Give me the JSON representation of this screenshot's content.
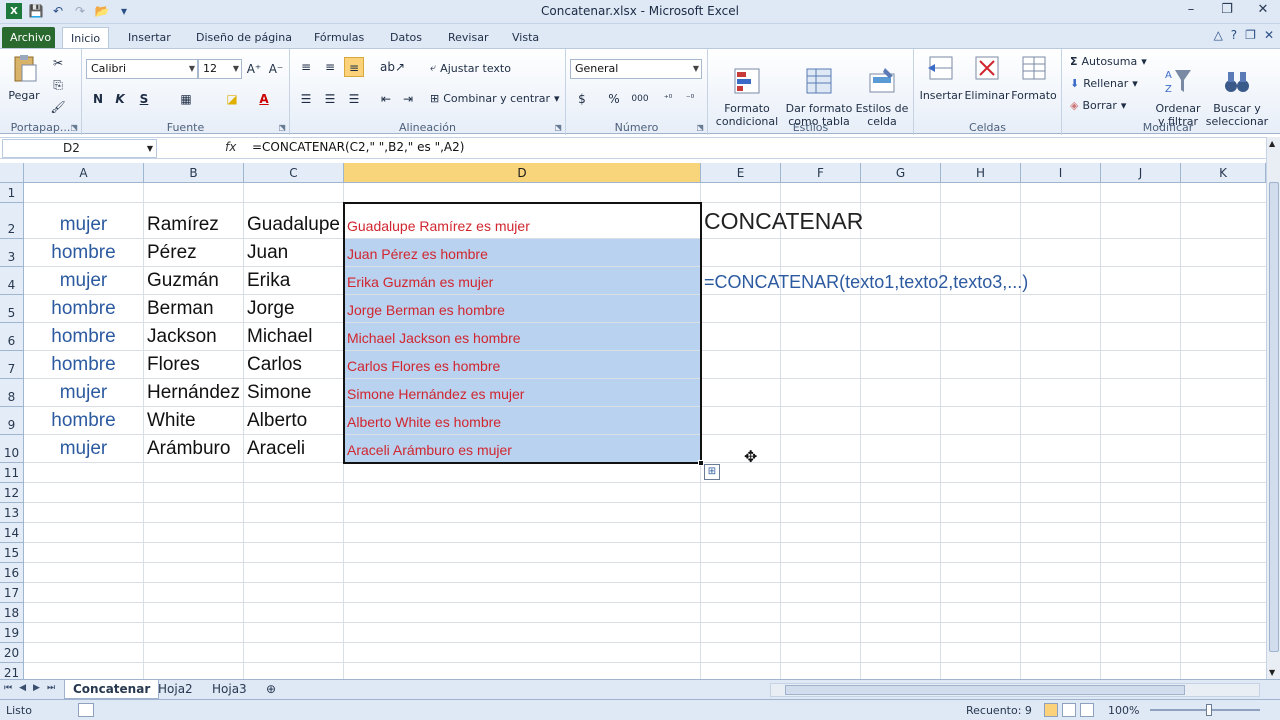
{
  "window": {
    "title": "Concatenar.xlsx - Microsoft Excel",
    "controls": [
      "–",
      "❐",
      "✕"
    ]
  },
  "ribbon_tabs": [
    "Archivo",
    "Inicio",
    "Insertar",
    "Diseño de página",
    "Fórmulas",
    "Datos",
    "Revisar",
    "Vista"
  ],
  "active_tab": "Inicio",
  "ribbon": {
    "clipboard": {
      "paste": "Pegar",
      "group": "Portapap..."
    },
    "font": {
      "name": "Calibri",
      "size": "12",
      "bold": "N",
      "italic": "K",
      "underline": "S",
      "group": "Fuente"
    },
    "alignment": {
      "wrap": "Ajustar texto",
      "merge": "Combinar y centrar",
      "group": "Alineación"
    },
    "number": {
      "format": "General",
      "currency": "$",
      "percent": "%",
      "thousands": "000",
      "group": "Número"
    },
    "styles": {
      "cond": "Formato\ncondicional",
      "table": "Dar formato\ncomo tabla",
      "cell": "Estilos de\ncelda",
      "group": "Estilos"
    },
    "cells": {
      "insert": "Insertar",
      "delete": "Eliminar",
      "format": "Formato",
      "group": "Celdas"
    },
    "editing": {
      "autosum": "Autosuma",
      "fill": "Rellenar",
      "clear": "Borrar",
      "sort": "Ordenar\ny filtrar",
      "find": "Buscar y\nseleccionar",
      "group": "Modificar"
    }
  },
  "formula_bar": {
    "name_box": "D2",
    "fx": "fx",
    "formula": "=CONCATENAR(C2,\" \",B2,\" es \",A2)"
  },
  "columns": [
    "A",
    "B",
    "C",
    "D",
    "E",
    "F",
    "G",
    "H",
    "I",
    "J",
    "K"
  ],
  "rows": [
    "1",
    "2",
    "3",
    "4",
    "5",
    "6",
    "7",
    "8",
    "9",
    "10",
    "11",
    "12",
    "13",
    "14",
    "15",
    "16",
    "17",
    "18",
    "19",
    "20",
    "21"
  ],
  "sheet": {
    "A": [
      "mujer",
      "hombre",
      "mujer",
      "hombre",
      "hombre",
      "hombre",
      "mujer",
      "hombre",
      "mujer"
    ],
    "B": [
      "Ramírez",
      "Pérez",
      "Guzmán",
      "Berman",
      "Jackson",
      "Flores",
      "Hernández",
      "White",
      "Arámburo"
    ],
    "C": [
      "Guadalupe",
      "Juan",
      "Erika",
      "Jorge",
      "Michael",
      "Carlos",
      "Simone",
      "Alberto",
      "Araceli"
    ],
    "D": [
      "Guadalupe Ramírez es mujer",
      "Juan Pérez es hombre",
      "Erika Guzmán es mujer",
      "Jorge Berman es hombre",
      "Michael Jackson es hombre",
      "Carlos Flores es hombre",
      "Simone Hernández es mujer",
      "Alberto White es hombre",
      "Araceli Arámburo es mujer"
    ],
    "E2": "CONCATENAR",
    "E4": "=CONCATENAR(texto1,texto2,texto3,...)"
  },
  "sheet_tabs": [
    "Concatenar",
    "Hoja2",
    "Hoja3"
  ],
  "active_sheet": "Concatenar",
  "status": {
    "ready": "Listo",
    "count": "Recuento: 9",
    "zoom": "100%"
  },
  "colors": {
    "selection_fill": "#b8d2ef",
    "result_text": "#d1262f",
    "gender_text": "#2c5aa0",
    "file_tab": "#2a6a2f"
  }
}
